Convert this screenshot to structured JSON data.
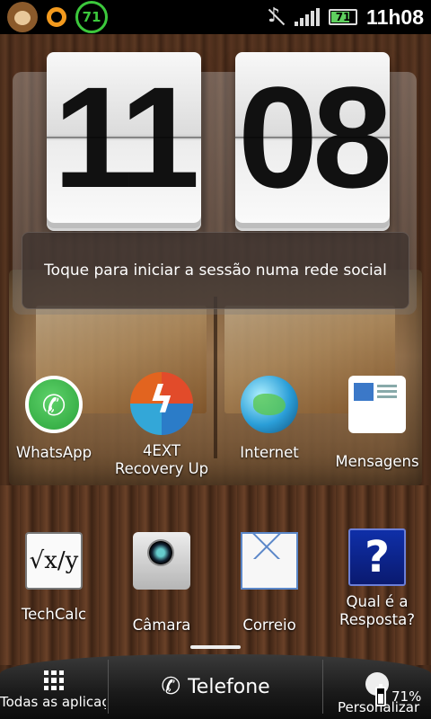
{
  "status_bar": {
    "battery_ring_value": "71",
    "battery_level": "71",
    "time": "11h08",
    "icons": [
      "monkey-app-icon",
      "orange-ring-icon",
      "battery-ring-icon",
      "mute-icon",
      "signal-icon",
      "battery-icon"
    ]
  },
  "clock_widget": {
    "hours": "11",
    "minutes": "08",
    "social_prompt": "Toque para iniciar a sessão numa rede social"
  },
  "apps": [
    {
      "label": "WhatsApp",
      "icon": "whatsapp-icon"
    },
    {
      "label": "4EXT",
      "label2": "Recovery Up",
      "icon": "4ext-icon"
    },
    {
      "label": "Internet",
      "icon": "globe-icon"
    },
    {
      "label": "Mensagens",
      "icon": "messages-icon"
    },
    {
      "label": "TechCalc",
      "icon": "calculator-icon"
    },
    {
      "label": "Câmara",
      "icon": "camera-icon"
    },
    {
      "label": "Correio",
      "icon": "mail-icon"
    },
    {
      "label": "Qual é a",
      "label2": "Resposta?",
      "icon": "question-icon"
    }
  ],
  "dock": {
    "all_apps_label": "Todas as aplicações",
    "phone_label": "Telefone",
    "personalize_label": "Personalizar",
    "battery_percent": "71%"
  }
}
